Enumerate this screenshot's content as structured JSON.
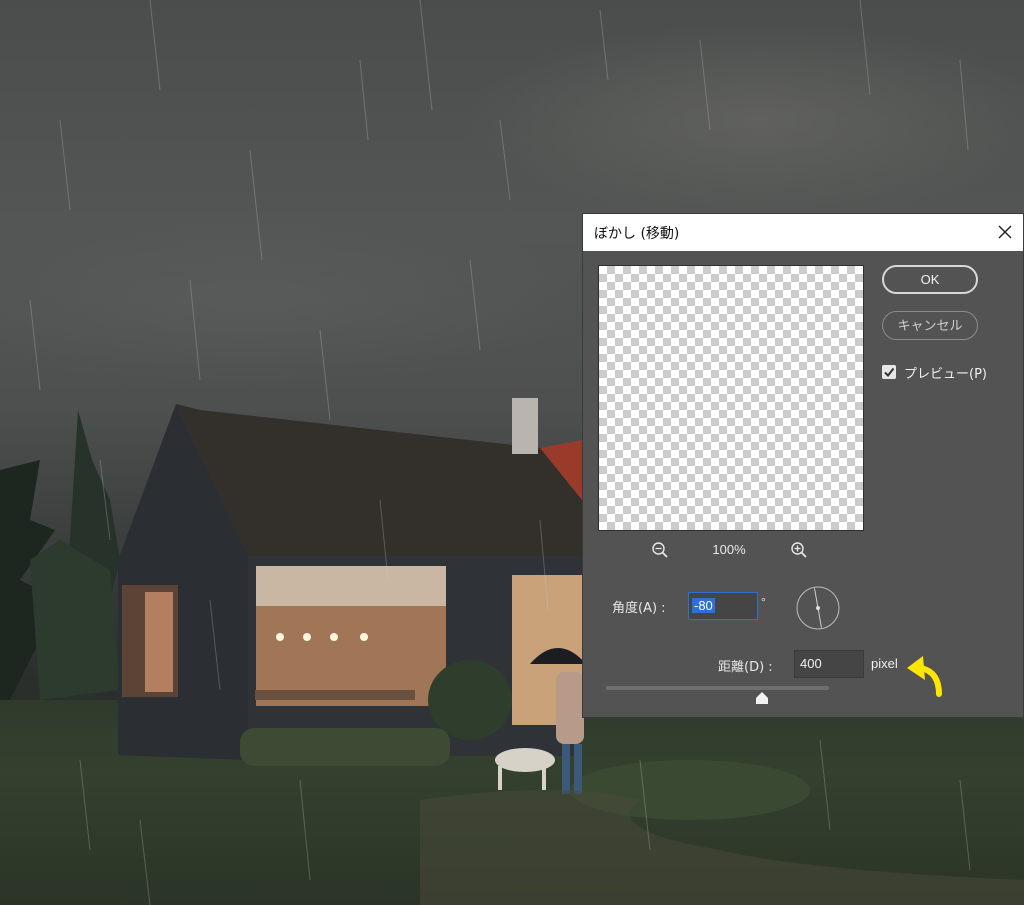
{
  "dialog": {
    "title": "ぼかし (移動)",
    "zoom_level": "100%",
    "ok_label": "OK",
    "cancel_label": "キャンセル",
    "preview_label": "プレビュー(P)",
    "preview_checked": true,
    "angle_label": "角度(A) :",
    "angle_value": "-80",
    "angle_unit": "°",
    "distance_label": "距離(D) :",
    "distance_value": "400",
    "distance_unit": "pixel",
    "distance_slider_fraction": 0.7
  },
  "icons": {
    "close": "close-icon",
    "zoom_out": "zoom-out-icon",
    "zoom_in": "zoom-in-icon",
    "checkbox": "checkmark-icon",
    "annotation": "curved-arrow-icon"
  },
  "colors": {
    "dialog_bg": "#535353",
    "selection": "#2f6fd6",
    "annotation_arrow": "#ffe600"
  }
}
